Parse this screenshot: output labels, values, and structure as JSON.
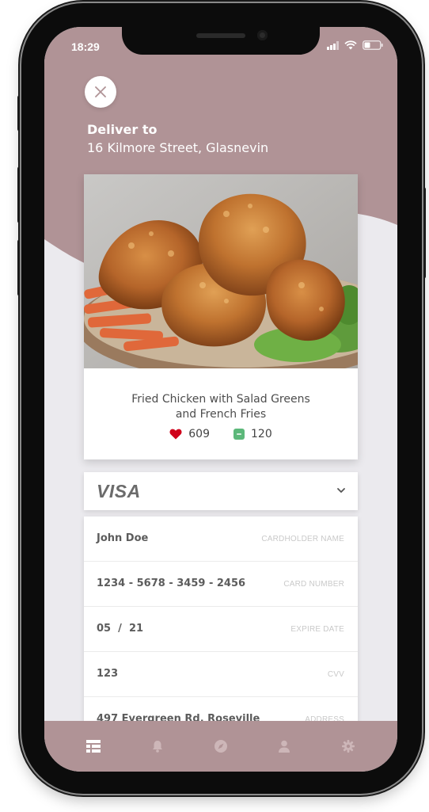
{
  "status_bar": {
    "time": "18:29"
  },
  "header": {
    "deliver_to_label": "Deliver to",
    "address": "16 Kilmore Street, Glasnevin"
  },
  "food": {
    "title_line1": "Fried Chicken with Salad Greens",
    "title_line2": "and French Fries",
    "likes": "609",
    "comments": "120"
  },
  "payment": {
    "card_brand": "VISA",
    "fields": [
      {
        "value": "John Doe",
        "label": "CARDHOLDER NAME"
      },
      {
        "value": "1234 - 5678 - 3459 - 2456",
        "label": "CARD NUMBER"
      },
      {
        "value": "05  /  21",
        "label": "EXPIRE DATE"
      },
      {
        "value": "123",
        "label": "CVV"
      },
      {
        "value": "497 Evergreen Rd. Roseville",
        "label": "ADDRESS"
      }
    ]
  },
  "tab_bar": {
    "items": [
      "list-icon",
      "bell-icon",
      "compass-icon",
      "user-icon",
      "gear-icon"
    ]
  },
  "colors": {
    "accent": "#b09396",
    "background": "#ebeaee",
    "heart": "#d0021b",
    "comment": "#5cb87a"
  }
}
